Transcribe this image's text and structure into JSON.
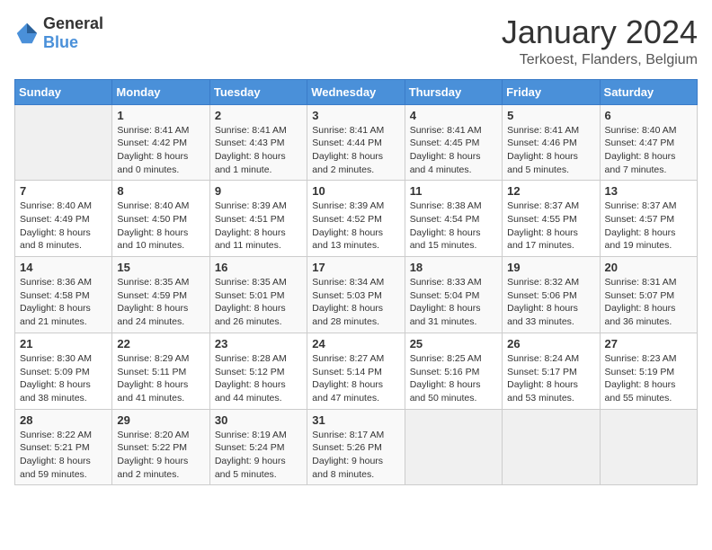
{
  "header": {
    "logo_general": "General",
    "logo_blue": "Blue",
    "month_title": "January 2024",
    "location": "Terkoest, Flanders, Belgium"
  },
  "calendar": {
    "days_of_week": [
      "Sunday",
      "Monday",
      "Tuesday",
      "Wednesday",
      "Thursday",
      "Friday",
      "Saturday"
    ],
    "weeks": [
      [
        {
          "day": "",
          "sunrise": "",
          "sunset": "",
          "daylight": ""
        },
        {
          "day": "1",
          "sunrise": "Sunrise: 8:41 AM",
          "sunset": "Sunset: 4:42 PM",
          "daylight": "Daylight: 8 hours and 0 minutes."
        },
        {
          "day": "2",
          "sunrise": "Sunrise: 8:41 AM",
          "sunset": "Sunset: 4:43 PM",
          "daylight": "Daylight: 8 hours and 1 minute."
        },
        {
          "day": "3",
          "sunrise": "Sunrise: 8:41 AM",
          "sunset": "Sunset: 4:44 PM",
          "daylight": "Daylight: 8 hours and 2 minutes."
        },
        {
          "day": "4",
          "sunrise": "Sunrise: 8:41 AM",
          "sunset": "Sunset: 4:45 PM",
          "daylight": "Daylight: 8 hours and 4 minutes."
        },
        {
          "day": "5",
          "sunrise": "Sunrise: 8:41 AM",
          "sunset": "Sunset: 4:46 PM",
          "daylight": "Daylight: 8 hours and 5 minutes."
        },
        {
          "day": "6",
          "sunrise": "Sunrise: 8:40 AM",
          "sunset": "Sunset: 4:47 PM",
          "daylight": "Daylight: 8 hours and 7 minutes."
        }
      ],
      [
        {
          "day": "7",
          "sunrise": "Sunrise: 8:40 AM",
          "sunset": "Sunset: 4:49 PM",
          "daylight": "Daylight: 8 hours and 8 minutes."
        },
        {
          "day": "8",
          "sunrise": "Sunrise: 8:40 AM",
          "sunset": "Sunset: 4:50 PM",
          "daylight": "Daylight: 8 hours and 10 minutes."
        },
        {
          "day": "9",
          "sunrise": "Sunrise: 8:39 AM",
          "sunset": "Sunset: 4:51 PM",
          "daylight": "Daylight: 8 hours and 11 minutes."
        },
        {
          "day": "10",
          "sunrise": "Sunrise: 8:39 AM",
          "sunset": "Sunset: 4:52 PM",
          "daylight": "Daylight: 8 hours and 13 minutes."
        },
        {
          "day": "11",
          "sunrise": "Sunrise: 8:38 AM",
          "sunset": "Sunset: 4:54 PM",
          "daylight": "Daylight: 8 hours and 15 minutes."
        },
        {
          "day": "12",
          "sunrise": "Sunrise: 8:37 AM",
          "sunset": "Sunset: 4:55 PM",
          "daylight": "Daylight: 8 hours and 17 minutes."
        },
        {
          "day": "13",
          "sunrise": "Sunrise: 8:37 AM",
          "sunset": "Sunset: 4:57 PM",
          "daylight": "Daylight: 8 hours and 19 minutes."
        }
      ],
      [
        {
          "day": "14",
          "sunrise": "Sunrise: 8:36 AM",
          "sunset": "Sunset: 4:58 PM",
          "daylight": "Daylight: 8 hours and 21 minutes."
        },
        {
          "day": "15",
          "sunrise": "Sunrise: 8:35 AM",
          "sunset": "Sunset: 4:59 PM",
          "daylight": "Daylight: 8 hours and 24 minutes."
        },
        {
          "day": "16",
          "sunrise": "Sunrise: 8:35 AM",
          "sunset": "Sunset: 5:01 PM",
          "daylight": "Daylight: 8 hours and 26 minutes."
        },
        {
          "day": "17",
          "sunrise": "Sunrise: 8:34 AM",
          "sunset": "Sunset: 5:03 PM",
          "daylight": "Daylight: 8 hours and 28 minutes."
        },
        {
          "day": "18",
          "sunrise": "Sunrise: 8:33 AM",
          "sunset": "Sunset: 5:04 PM",
          "daylight": "Daylight: 8 hours and 31 minutes."
        },
        {
          "day": "19",
          "sunrise": "Sunrise: 8:32 AM",
          "sunset": "Sunset: 5:06 PM",
          "daylight": "Daylight: 8 hours and 33 minutes."
        },
        {
          "day": "20",
          "sunrise": "Sunrise: 8:31 AM",
          "sunset": "Sunset: 5:07 PM",
          "daylight": "Daylight: 8 hours and 36 minutes."
        }
      ],
      [
        {
          "day": "21",
          "sunrise": "Sunrise: 8:30 AM",
          "sunset": "Sunset: 5:09 PM",
          "daylight": "Daylight: 8 hours and 38 minutes."
        },
        {
          "day": "22",
          "sunrise": "Sunrise: 8:29 AM",
          "sunset": "Sunset: 5:11 PM",
          "daylight": "Daylight: 8 hours and 41 minutes."
        },
        {
          "day": "23",
          "sunrise": "Sunrise: 8:28 AM",
          "sunset": "Sunset: 5:12 PM",
          "daylight": "Daylight: 8 hours and 44 minutes."
        },
        {
          "day": "24",
          "sunrise": "Sunrise: 8:27 AM",
          "sunset": "Sunset: 5:14 PM",
          "daylight": "Daylight: 8 hours and 47 minutes."
        },
        {
          "day": "25",
          "sunrise": "Sunrise: 8:25 AM",
          "sunset": "Sunset: 5:16 PM",
          "daylight": "Daylight: 8 hours and 50 minutes."
        },
        {
          "day": "26",
          "sunrise": "Sunrise: 8:24 AM",
          "sunset": "Sunset: 5:17 PM",
          "daylight": "Daylight: 8 hours and 53 minutes."
        },
        {
          "day": "27",
          "sunrise": "Sunrise: 8:23 AM",
          "sunset": "Sunset: 5:19 PM",
          "daylight": "Daylight: 8 hours and 55 minutes."
        }
      ],
      [
        {
          "day": "28",
          "sunrise": "Sunrise: 8:22 AM",
          "sunset": "Sunset: 5:21 PM",
          "daylight": "Daylight: 8 hours and 59 minutes."
        },
        {
          "day": "29",
          "sunrise": "Sunrise: 8:20 AM",
          "sunset": "Sunset: 5:22 PM",
          "daylight": "Daylight: 9 hours and 2 minutes."
        },
        {
          "day": "30",
          "sunrise": "Sunrise: 8:19 AM",
          "sunset": "Sunset: 5:24 PM",
          "daylight": "Daylight: 9 hours and 5 minutes."
        },
        {
          "day": "31",
          "sunrise": "Sunrise: 8:17 AM",
          "sunset": "Sunset: 5:26 PM",
          "daylight": "Daylight: 9 hours and 8 minutes."
        },
        {
          "day": "",
          "sunrise": "",
          "sunset": "",
          "daylight": ""
        },
        {
          "day": "",
          "sunrise": "",
          "sunset": "",
          "daylight": ""
        },
        {
          "day": "",
          "sunrise": "",
          "sunset": "",
          "daylight": ""
        }
      ]
    ]
  }
}
